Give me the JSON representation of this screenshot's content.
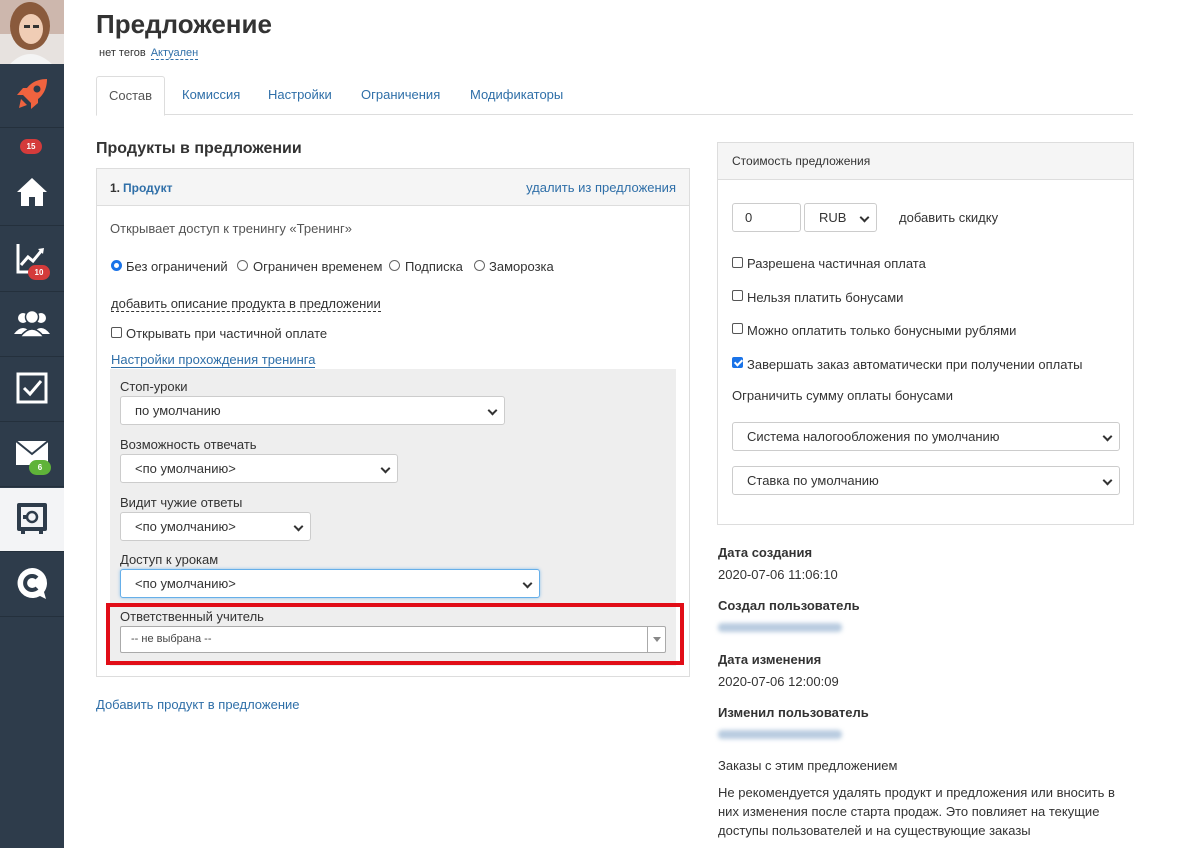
{
  "sidebar": {
    "items": [
      {
        "name": "rocket",
        "badge": "15",
        "badge_color": "#d43b3b"
      },
      {
        "name": "home",
        "badge": ""
      },
      {
        "name": "chart",
        "badge": "10",
        "badge_color": "#d43b3b"
      },
      {
        "name": "users",
        "badge": ""
      },
      {
        "name": "tasks",
        "badge": ""
      },
      {
        "name": "mail",
        "badge": "6",
        "badge_color": "#5fb339"
      },
      {
        "name": "safe",
        "badge": "",
        "active": true
      },
      {
        "name": "chat",
        "badge": ""
      }
    ]
  },
  "header": {
    "title": "Предложение",
    "tags_text": "нет тегов",
    "status": "Актуален"
  },
  "tabs": [
    "Состав",
    "Комиссия",
    "Настройки",
    "Ограничения",
    "Модификаторы"
  ],
  "products": {
    "section_title": "Продукты в предложении",
    "item": {
      "number": "1.",
      "name": "Продукт",
      "remove_link": "удалить из предложения",
      "access_text": "Открывает доступ к тренингу «Тренинг»",
      "options": [
        "Без ограничений",
        "Ограничен временем",
        "Подписка",
        "Заморозка"
      ],
      "selected_option": "Без ограничений",
      "add_description": "добавить описание продукта в предложении",
      "partial_payment_label": "Открывать при частичной оплате",
      "partial_payment_checked": false,
      "training_settings_link": "Настройки прохождения тренинга",
      "fields": {
        "stop_lessons": {
          "label": "Стоп-уроки",
          "value": "по умолчанию"
        },
        "can_answer": {
          "label": "Возможность отвечать",
          "value": "<по умолчанию>"
        },
        "sees_answers": {
          "label": "Видит чужие ответы",
          "value": "<по умолчанию>"
        },
        "lesson_access": {
          "label": "Доступ к урокам",
          "value": "<по умолчанию>"
        },
        "teacher": {
          "label": "Ответственный учитель",
          "value": "-- не выбрана --"
        }
      }
    },
    "add_product_link": "Добавить продукт в предложение"
  },
  "price": {
    "header": "Стоимость предложения",
    "amount": "0",
    "currency": "RUB",
    "add_discount": "добавить скидку",
    "checkboxes": [
      {
        "label": "Разрешена частичная оплата",
        "checked": false
      },
      {
        "label": "Нельзя платить бонусами",
        "checked": false
      },
      {
        "label": "Можно оплатить только бонусными рублями",
        "checked": false
      },
      {
        "label": "Завершать заказ автоматически при получении оплаты",
        "checked": true
      }
    ],
    "limit_bonus_link": "Ограничить сумму оплаты бонусами",
    "tax_system": "Система налогообложения по умолчанию",
    "tax_rate": "Ставка по умолчанию"
  },
  "meta": {
    "created_label": "Дата создания",
    "created_value": "2020-07-06 11:06:10",
    "created_by_label": "Создал пользователь",
    "modified_label": "Дата изменения",
    "modified_value": "2020-07-06 12:00:09",
    "modified_by_label": "Изменил пользователь",
    "orders_link": "Заказы с этим предложением",
    "note": "Не рекомендуется удалять продукт и предложения или вносить в них изменения после старта продаж. Это повлияет на текущие доступы пользователей и на существующие заказы"
  },
  "colors": {
    "sidebar": "#2e3c4b",
    "link": "#2f6fa8",
    "highlight": "#e10d17",
    "checkbox_accent": "#1a73e8"
  }
}
